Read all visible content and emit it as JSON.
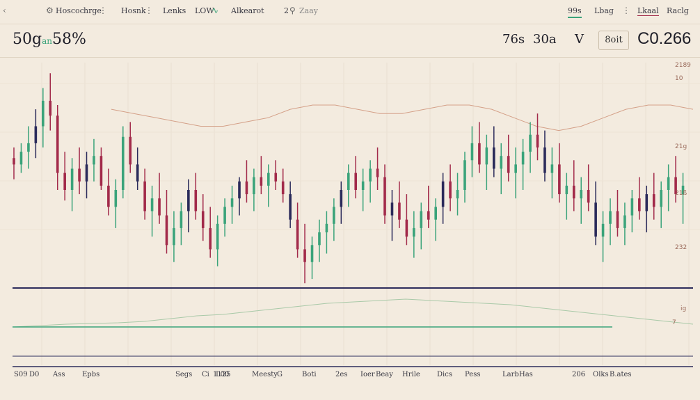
{
  "topbar": {
    "menu": [
      {
        "label": "Hoscoc"
      },
      {
        "label": "hrge"
      },
      {
        "label": "Hosnk"
      },
      {
        "label": "Lenks"
      },
      {
        "label": "LOW"
      },
      {
        "label": "Alkearot"
      },
      {
        "label": "2"
      },
      {
        "label": "Zaay"
      },
      {
        "label": "99s"
      },
      {
        "label": "Lbag"
      },
      {
        "label": "Lkaal"
      },
      {
        "label": "Raclg"
      }
    ]
  },
  "header": {
    "symbol": "50g",
    "symbol_suffix": "an",
    "change": "58%",
    "stats": [
      "76s",
      "30a",
      "V",
      "8oit"
    ],
    "last_price": "C0.266"
  },
  "colors": {
    "background": "#f3ebdf",
    "bull": "#3aa37a",
    "bear": "#a22a4a",
    "neutral": "#2a2a5a",
    "ma": "#d4a088",
    "baseline": "#2d2d5c"
  },
  "right_axis": {
    "labels": [
      "2189",
      "10",
      "21g",
      "21ß",
      "232"
    ]
  },
  "sub_axis": {
    "labels": [
      "ig",
      "7"
    ]
  },
  "bottom_axis": {
    "labels": [
      "S09",
      "D0",
      "Ass",
      "Epbs",
      "Segs",
      "Ci",
      "1125",
      "L00",
      "Meesty",
      "G",
      "Boti",
      "2es",
      "Ioer",
      "Beay",
      "Hrile",
      "Dics",
      "Pess",
      "Larb",
      "Has",
      "206",
      "Olks",
      "B.ates"
    ]
  },
  "chart_data": {
    "type": "candlestick",
    "title": "",
    "xlabel": "",
    "ylabel": "",
    "ylim": [
      0,
      100
    ],
    "candles": [
      [
        55,
        60,
        45,
        52
      ],
      [
        52,
        62,
        48,
        58
      ],
      [
        58,
        70,
        50,
        62
      ],
      [
        62,
        78,
        55,
        70
      ],
      [
        70,
        88,
        60,
        82
      ],
      [
        82,
        95,
        68,
        75
      ],
      [
        75,
        80,
        40,
        48
      ],
      [
        48,
        58,
        35,
        40
      ],
      [
        40,
        55,
        30,
        50
      ],
      [
        50,
        60,
        38,
        44
      ],
      [
        44,
        58,
        36,
        52
      ],
      [
        52,
        64,
        44,
        56
      ],
      [
        56,
        60,
        40,
        42
      ],
      [
        42,
        50,
        28,
        32
      ],
      [
        32,
        45,
        22,
        40
      ],
      [
        40,
        70,
        36,
        65
      ],
      [
        65,
        72,
        48,
        52
      ],
      [
        52,
        60,
        40,
        44
      ],
      [
        44,
        50,
        26,
        30
      ],
      [
        30,
        42,
        18,
        36
      ],
      [
        36,
        48,
        24,
        28
      ],
      [
        28,
        40,
        10,
        14
      ],
      [
        14,
        30,
        6,
        22
      ],
      [
        22,
        34,
        14,
        30
      ],
      [
        30,
        45,
        20,
        40
      ],
      [
        40,
        48,
        26,
        30
      ],
      [
        30,
        38,
        16,
        22
      ],
      [
        22,
        32,
        8,
        12
      ],
      [
        12,
        28,
        4,
        24
      ],
      [
        24,
        36,
        18,
        32
      ],
      [
        32,
        42,
        24,
        36
      ],
      [
        36,
        46,
        28,
        44
      ],
      [
        44,
        54,
        34,
        38
      ],
      [
        38,
        50,
        30,
        46
      ],
      [
        46,
        56,
        38,
        42
      ],
      [
        42,
        52,
        32,
        48
      ],
      [
        48,
        54,
        40,
        44
      ],
      [
        44,
        50,
        34,
        38
      ],
      [
        38,
        44,
        22,
        26
      ],
      [
        26,
        34,
        8,
        12
      ],
      [
        12,
        24,
        -4,
        6
      ],
      [
        6,
        18,
        -2,
        14
      ],
      [
        14,
        26,
        6,
        20
      ],
      [
        20,
        30,
        10,
        24
      ],
      [
        24,
        36,
        16,
        32
      ],
      [
        32,
        44,
        24,
        40
      ],
      [
        40,
        52,
        32,
        48
      ],
      [
        48,
        56,
        36,
        40
      ],
      [
        40,
        50,
        30,
        44
      ],
      [
        44,
        54,
        34,
        50
      ],
      [
        50,
        60,
        40,
        46
      ],
      [
        46,
        52,
        24,
        28
      ],
      [
        28,
        40,
        16,
        34
      ],
      [
        34,
        44,
        22,
        26
      ],
      [
        26,
        38,
        14,
        18
      ],
      [
        18,
        30,
        8,
        22
      ],
      [
        22,
        34,
        12,
        30
      ],
      [
        30,
        42,
        22,
        26
      ],
      [
        26,
        36,
        16,
        32
      ],
      [
        32,
        48,
        24,
        44
      ],
      [
        44,
        52,
        30,
        36
      ],
      [
        36,
        48,
        28,
        40
      ],
      [
        40,
        58,
        34,
        54
      ],
      [
        54,
        70,
        46,
        62
      ],
      [
        62,
        72,
        48,
        52
      ],
      [
        52,
        66,
        40,
        60
      ],
      [
        60,
        70,
        46,
        50
      ],
      [
        50,
        62,
        38,
        56
      ],
      [
        56,
        66,
        44,
        48
      ],
      [
        48,
        60,
        36,
        52
      ],
      [
        52,
        64,
        40,
        58
      ],
      [
        58,
        72,
        48,
        66
      ],
      [
        66,
        76,
        54,
        60
      ],
      [
        60,
        68,
        44,
        48
      ],
      [
        48,
        60,
        36,
        52
      ],
      [
        52,
        62,
        34,
        38
      ],
      [
        38,
        48,
        26,
        42
      ],
      [
        42,
        54,
        30,
        36
      ],
      [
        36,
        46,
        24,
        40
      ],
      [
        40,
        52,
        30,
        34
      ],
      [
        34,
        44,
        14,
        18
      ],
      [
        18,
        30,
        6,
        24
      ],
      [
        24,
        36,
        14,
        30
      ],
      [
        30,
        40,
        18,
        22
      ],
      [
        22,
        34,
        14,
        28
      ],
      [
        28,
        40,
        20,
        36
      ],
      [
        36,
        46,
        26,
        30
      ],
      [
        30,
        42,
        20,
        38
      ],
      [
        38,
        48,
        26,
        32
      ],
      [
        32,
        44,
        22,
        40
      ],
      [
        40,
        52,
        30,
        46
      ],
      [
        46,
        56,
        34,
        38
      ],
      [
        38,
        48,
        24,
        42
      ]
    ],
    "ma_line": [
      78,
      76,
      74,
      72,
      70,
      70,
      72,
      74,
      78,
      80,
      80,
      78,
      76,
      76,
      78,
      80,
      80,
      78,
      74,
      70,
      68,
      70,
      74,
      78,
      80,
      80,
      78
    ],
    "sub_line": [
      50,
      52,
      54,
      55,
      56,
      58,
      62,
      66,
      68,
      72,
      76,
      80,
      84,
      86,
      88,
      90,
      88,
      86,
      84,
      82,
      78,
      74,
      70,
      66,
      62,
      58,
      54
    ]
  }
}
